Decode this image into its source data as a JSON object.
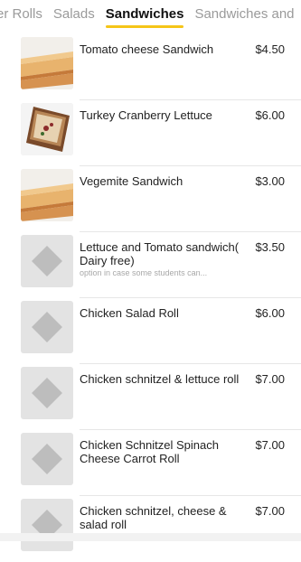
{
  "tabs": [
    {
      "label": "er Rolls",
      "active": false
    },
    {
      "label": "Salads",
      "active": false
    },
    {
      "label": "Sandwiches",
      "active": true
    },
    {
      "label": "Sandwiches and",
      "active": false
    }
  ],
  "colors": {
    "accent": "#f5c518",
    "placeholder_bg": "#e3e3e3",
    "placeholder_icon": "#bdbdbd"
  },
  "items": [
    {
      "name": "Tomato cheese Sandwich",
      "price": "$4.50",
      "description": "",
      "image": "toasted-sandwich-photo"
    },
    {
      "name": "Turkey Cranberry Lettuce",
      "price": "$6.00",
      "description": "",
      "image": "grilled-sandwich-photo"
    },
    {
      "name": "Vegemite Sandwich",
      "price": "$3.00",
      "description": "",
      "image": "toasted-sandwich-photo"
    },
    {
      "name": "Lettuce and Tomato sandwich( Dairy free)",
      "price": "$3.50",
      "description": "option in case some students can...",
      "image": "placeholder-icon"
    },
    {
      "name": "Chicken Salad Roll",
      "price": "$6.00",
      "description": "",
      "image": "placeholder-icon"
    },
    {
      "name": "Chicken schnitzel & lettuce roll",
      "price": "$7.00",
      "description": "",
      "image": "placeholder-icon"
    },
    {
      "name": "Chicken Schnitzel Spinach Cheese Carrot Roll",
      "price": "$7.00",
      "description": "",
      "image": "placeholder-icon"
    },
    {
      "name": "Chicken schnitzel, cheese & salad roll",
      "price": "$7.00",
      "description": "",
      "image": "placeholder-icon"
    }
  ]
}
